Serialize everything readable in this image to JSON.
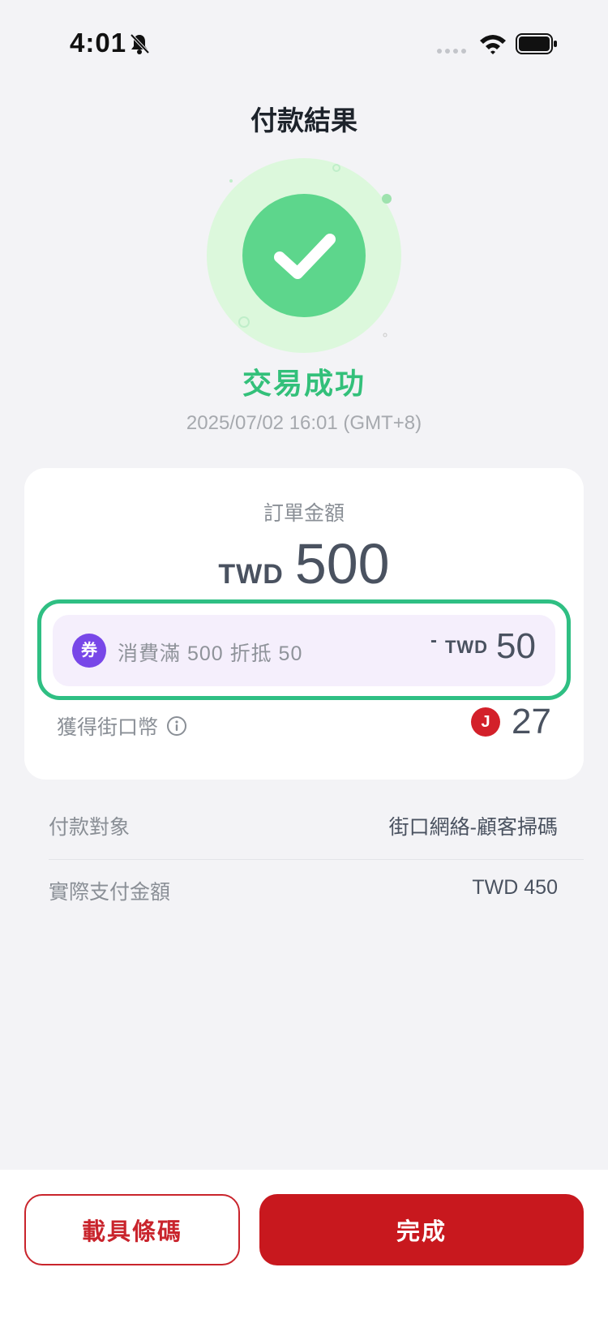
{
  "status_bar": {
    "time": "4:01",
    "icons": [
      "bell-slash-icon",
      "signal-icon",
      "wifi-icon",
      "battery-icon"
    ]
  },
  "header": {
    "title": "付款結果"
  },
  "result": {
    "status_text": "交易成功",
    "timestamp": "2025/07/02 16:01 (GMT+8)",
    "icon": "check-icon"
  },
  "order": {
    "label": "訂單金額",
    "currency": "TWD",
    "amount": "500"
  },
  "coupon": {
    "badge": "券",
    "description": "消費滿 500 折抵 50",
    "minus": "-",
    "currency": "TWD",
    "amount": "50"
  },
  "coins": {
    "label": "獲得街口幣",
    "coin_badge": "J",
    "value": "27"
  },
  "details": [
    {
      "label": "付款對象",
      "value": "街口網絡-顧客掃碼"
    },
    {
      "label": "實際支付金額",
      "value": "TWD 450"
    }
  ],
  "actions": {
    "barcode_label": "載具條碼",
    "done_label": "完成"
  },
  "colors": {
    "success": "#33c07a",
    "brand_red": "#c8181e",
    "coupon_border": "#2fbf83",
    "coupon_badge": "#7847e8"
  }
}
